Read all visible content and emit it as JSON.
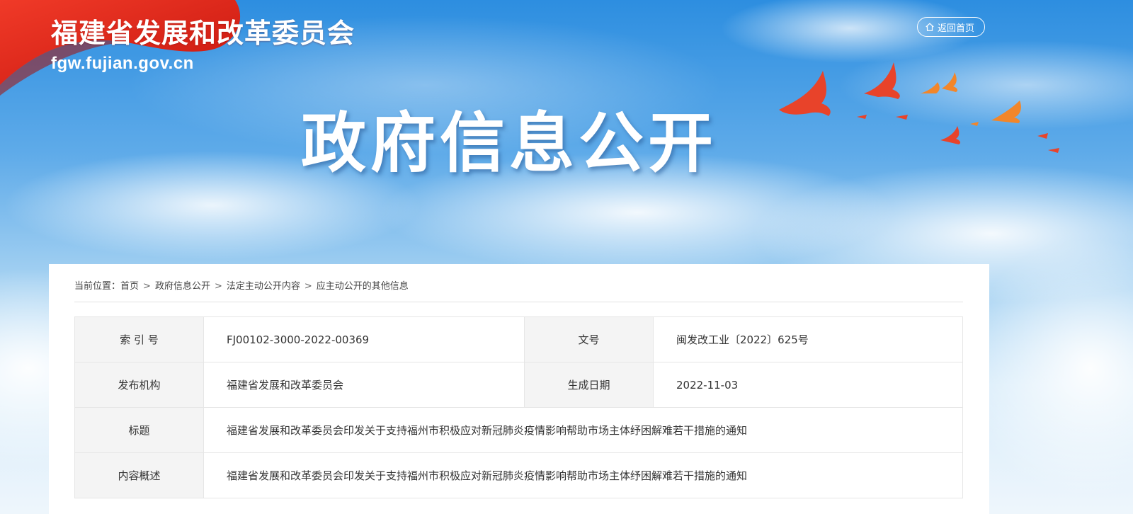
{
  "header": {
    "org_name": "福建省发展和改革委员会",
    "site_url": "fgw.fujian.gov.cn",
    "home_button": "返回首页",
    "banner_title": "政府信息公开"
  },
  "breadcrumb": {
    "prefix": "当前位置：",
    "items": [
      "首页",
      "政府信息公开",
      "法定主动公开内容",
      "应主动公开的其他信息"
    ],
    "separator": ">"
  },
  "info": {
    "index_label": "索 引 号",
    "index_value": "FJ00102-3000-2022-00369",
    "docno_label": "文号",
    "docno_value": "闽发改工业〔2022〕625号",
    "publisher_label": "发布机构",
    "publisher_value": "福建省发展和改革委员会",
    "date_label": "生成日期",
    "date_value": "2022-11-03",
    "title_label": "标题",
    "title_value": "福建省发展和改革委员会印发关于支持福州市积极应对新冠肺炎疫情影响帮助市场主体纾困解难若干措施的通知",
    "summary_label": "内容概述",
    "summary_value": "福建省发展和改革委员会印发关于支持福州市积极应对新冠肺炎疫情影响帮助市场主体纾困解难若干措施的通知"
  },
  "colors": {
    "sky_top": "#2d8ee0",
    "flag_red": "#e52a1d",
    "label_bg": "#f4f4f4"
  }
}
